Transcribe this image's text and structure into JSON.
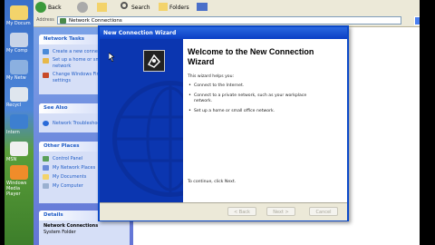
{
  "toolbar": {
    "back_label": "Back",
    "search_label": "Search",
    "folders_label": "Folders"
  },
  "address": {
    "label": "Address",
    "value": "Network Connections"
  },
  "desktop": {
    "icons": [
      "My Docum",
      "My Comp",
      "My Netw",
      "Recycl",
      "Intern",
      "MSN",
      "Windows Media Player"
    ]
  },
  "leftpane": {
    "network_tasks": {
      "title": "Network Tasks",
      "items": [
        "Create a new connection",
        "Set up a home or small office network",
        "Change Windows Firewall settings"
      ]
    },
    "see_also": {
      "title": "See Also",
      "items": [
        "Network Troubleshooter"
      ]
    },
    "other_places": {
      "title": "Other Places",
      "items": [
        "Control Panel",
        "My Network Places",
        "My Documents",
        "My Computer"
      ]
    },
    "details": {
      "title": "Details",
      "name": "Network Connections",
      "type": "System Folder"
    }
  },
  "wizard": {
    "title": "New Connection Wizard",
    "heading": "Welcome to the New Connection Wizard",
    "intro": "This wizard helps you:",
    "bullets": [
      "Connect to the Internet.",
      "Connect to a private network, such as your workplace network.",
      "Set up a home or small office network."
    ],
    "continue_text": "To continue, click Next.",
    "buttons": {
      "back": "< Back",
      "next": "Next >",
      "cancel": "Cancel"
    }
  }
}
